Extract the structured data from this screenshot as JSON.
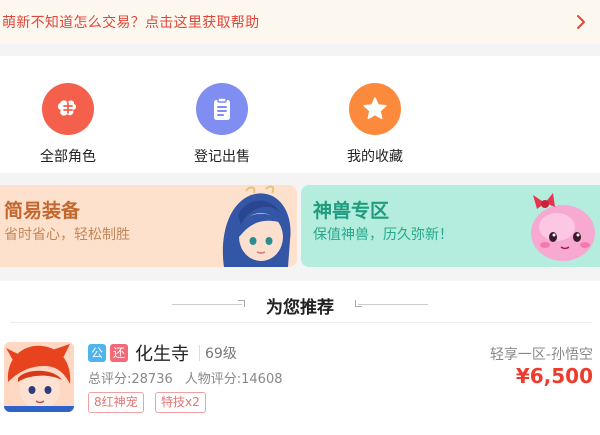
{
  "help": {
    "text": "萌新不知道怎么交易？点击这里获取帮助",
    "chevron_icon": "chevron-right-icon"
  },
  "quick_actions": [
    {
      "label": "全部角色",
      "icon": "dream-logo-icon",
      "color": "#f4604b"
    },
    {
      "label": "登记出售",
      "icon": "clipboard-icon",
      "color": "#7f8ef0"
    },
    {
      "label": "我的收藏",
      "icon": "star-icon",
      "color": "#fb8a3c"
    }
  ],
  "banners": {
    "easy_gear": {
      "title": "简易装备",
      "subtitle": "省时省心，轻松制胜",
      "bg": "#fde1cd",
      "title_color": "#c4672f",
      "sub_color": "#c4875a"
    },
    "pet_zone": {
      "title": "神兽专区",
      "subtitle": "保值神兽，历久弥新！",
      "bg": "#b4ecdd",
      "title_color": "#1f9c80",
      "sub_color": "#27a88b"
    }
  },
  "recommend": {
    "title": "为您推荐",
    "item": {
      "tag_public": "公",
      "tag_return": "还",
      "school": "化生寺",
      "level": "69级",
      "total_score": "总评分:28736",
      "char_score": "人物评分:14608",
      "chips": [
        "8红神宠",
        "特技x2"
      ],
      "server": "轻享一区-孙悟空",
      "price": "¥6,500"
    }
  }
}
